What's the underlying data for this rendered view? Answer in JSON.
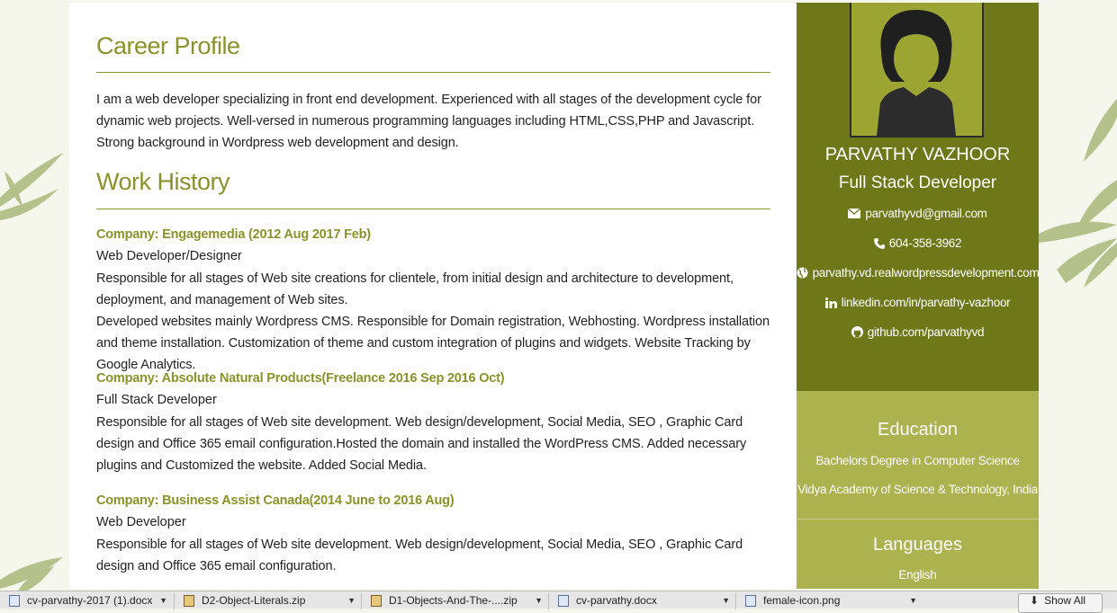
{
  "main": {
    "career_heading": "Career Profile",
    "career_text": "I am a web developer specializing in front end development. Experienced with all stages of the development cycle for dynamic web projects. Well-versed in numerous programming languages including HTML,CSS,PHP and Javascript. Strong background in Wordpress web development and design.",
    "work_heading": "Work History",
    "jobs": [
      {
        "company": "Company: Engagemedia (2012 Aug 2017 Feb)",
        "role": "Web Developer/Designer",
        "desc1": "Responsible for all stages of Web site creations for clientele, from initial design and architecture to development, deployment, and management of Web sites.",
        "desc2": "Developed websites mainly Wordpress CMS. Responsible for Domain registration, Webhosting. Wordpress installation and theme installation. Customization of theme and custom integration of plugins and widgets. Website Tracking by Google Analytics."
      },
      {
        "company": "Company: Absolute Natural Products(Freelance 2016 Sep 2016 Oct)",
        "role": "Full Stack Developer",
        "desc1": "Responsible for all stages of Web site development. Web design/development, Social Media, SEO , Graphic Card design and Office 365 email configuration.Hosted the domain and installed the WordPress CMS. Added necessary plugins and Customized the website. Added Social Media."
      },
      {
        "company": "Company: Business Assist Canada(2014 June to 2016 Aug)",
        "role": "Web Developer",
        "desc1": "Responsible for all stages of Web site development. Web design/development, Social Media, SEO , Graphic Card design and Office 365 email configuration."
      }
    ]
  },
  "sidebar": {
    "avatar_icon": "female-avatar-icon",
    "name": "PARVATHY VAZHOOR",
    "title": "Full Stack Developer",
    "contacts": [
      {
        "icon": "envelope-icon",
        "text": "parvathyvd@gmail.com"
      },
      {
        "icon": "phone-icon",
        "text": "604-358-3962"
      },
      {
        "icon": "globe-icon",
        "text": "parvathy.vd.realwordpressdevelopment.com"
      },
      {
        "icon": "linkedin-icon",
        "text": "linkedin.com/in/parvathy-vazhoor"
      },
      {
        "icon": "github-icon",
        "text": "github.com/parvathyvd"
      }
    ],
    "education_heading": "Education",
    "education_degree": "Bachelors Degree in Computer Science",
    "education_school": "Vidya Academy of Science & Technology, India",
    "languages_heading": "Languages",
    "language_1": "English"
  },
  "downloads_bar": {
    "items": [
      "cv-parvathy-2017 (1).docx",
      "D2-Object-Literals.zip",
      "D1-Objects-And-The-....zip",
      "cv-parvathy.docx",
      "female-icon.png"
    ],
    "show_all": "Show All"
  },
  "colors": {
    "accent": "#8a9229",
    "sidebar_dark": "#6e7819",
    "sidebar_light": "#abb24e"
  }
}
